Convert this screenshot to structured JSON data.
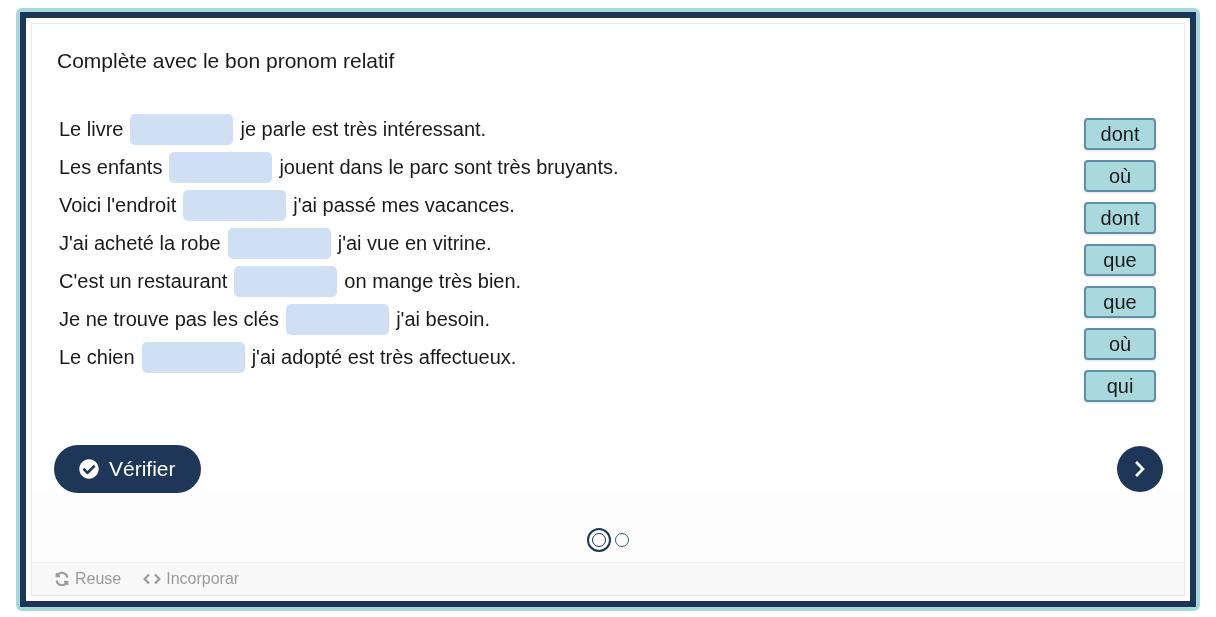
{
  "title": "Complète avec le bon pronom relatif",
  "sentences": [
    {
      "before": "Le livre",
      "after": "je parle est très intéressant."
    },
    {
      "before": "Les enfants",
      "after": "jouent dans le parc sont très bruyants."
    },
    {
      "before": "Voici l'endroit",
      "after": "j'ai passé mes vacances."
    },
    {
      "before": "J'ai acheté la robe",
      "after": "j'ai vue en vitrine."
    },
    {
      "before": "C'est un restaurant",
      "after": "on mange très bien."
    },
    {
      "before": "Je ne trouve pas les clés",
      "after": "j'ai besoin."
    },
    {
      "before": "Le chien",
      "after": "j'ai adopté est très affectueux."
    }
  ],
  "words": [
    "dont",
    "où",
    "dont",
    "que",
    "que",
    "où",
    "qui"
  ],
  "check_button": {
    "label": "Vérifier"
  },
  "slides": [
    {
      "selected": true
    },
    {
      "selected": false
    }
  ],
  "footer": [
    {
      "kind": "reuse",
      "label": "Reuse"
    },
    {
      "kind": "embed",
      "label": "Incorporar"
    }
  ]
}
